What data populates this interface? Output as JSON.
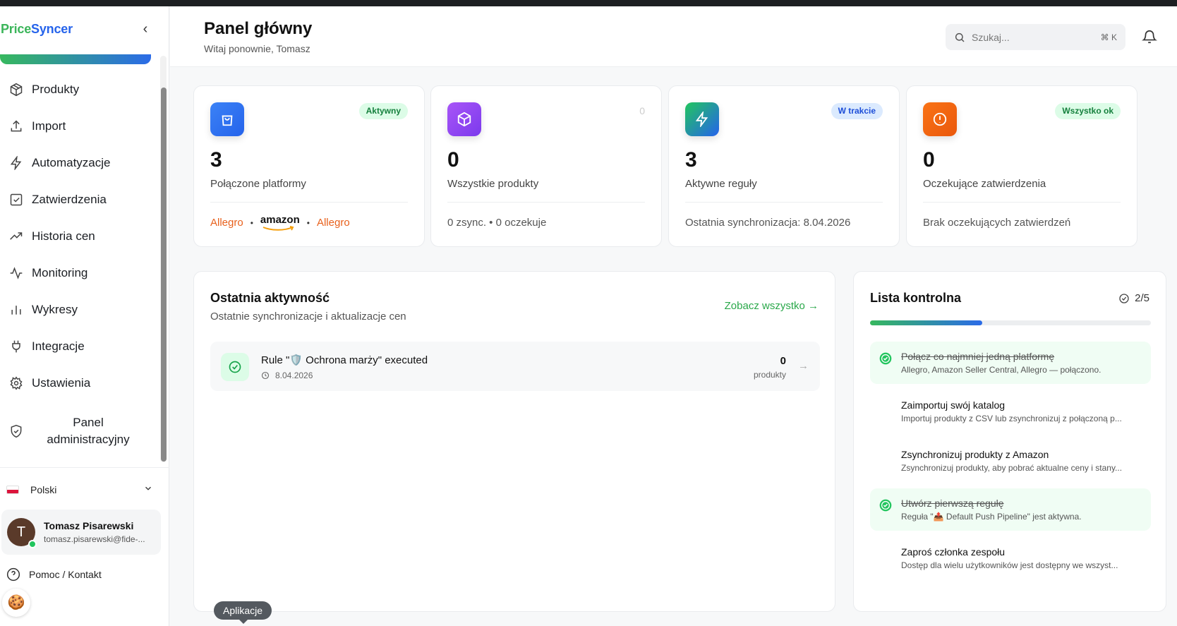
{
  "brand": {
    "part1": "Price",
    "part2": "Syncer"
  },
  "sidebar": {
    "items": [
      {
        "label": "Produkty"
      },
      {
        "label": "Import"
      },
      {
        "label": "Automatyzacje"
      },
      {
        "label": "Zatwierdzenia"
      },
      {
        "label": "Historia cen"
      },
      {
        "label": "Monitoring"
      },
      {
        "label": "Wykresy"
      },
      {
        "label": "Integracje"
      },
      {
        "label": "Ustawienia"
      },
      {
        "label": "Panel administracyjny"
      }
    ],
    "language": "Polski",
    "user": {
      "initial": "T",
      "name": "Tomasz Pisarewski",
      "email": "tomasz.pisarewski@fide-..."
    },
    "help": "Pomoc / Kontakt",
    "cookie_icon": "🍪"
  },
  "header": {
    "title": "Panel główny",
    "subtitle": "Witaj ponownie, Tomasz",
    "search_placeholder": "Szukaj...",
    "search_shortcut": "⌘ K"
  },
  "stats": [
    {
      "value": "3",
      "label": "Połączone platformy",
      "badge": "Aktywny",
      "platforms": [
        "Allegro",
        "amazon",
        "Allegro"
      ]
    },
    {
      "value": "0",
      "label": "Wszystkie produkty",
      "badge": "0",
      "footer": "0 zsync. • 0 oczekuje"
    },
    {
      "value": "3",
      "label": "Aktywne reguły",
      "badge": "W trakcie",
      "footer": "Ostatnia synchronizacja: 8.04.2026"
    },
    {
      "value": "0",
      "label": "Oczekujące zatwierdzenia",
      "badge": "Wszystko ok",
      "footer": "Brak oczekujących zatwierdzeń"
    }
  ],
  "activity": {
    "title": "Ostatnia aktywność",
    "subtitle": "Ostatnie synchronizacje i aktualizacje cen",
    "see_all": "Zobacz wszystko →",
    "rows": [
      {
        "title": "Rule \"🛡️ Ochrona marży\" executed",
        "date": "8.04.2026",
        "count": "0",
        "unit": "produkty"
      }
    ]
  },
  "tooltip": "Aplikacje",
  "checklist": {
    "title": "Lista kontrolna",
    "count": "2/5",
    "progress": 0.4,
    "items": [
      {
        "title": "Połącz co najmniej jedną platformę",
        "desc": "Allegro, Amazon Seller Central, Allegro — połączono.",
        "done": true
      },
      {
        "title": "Zaimportuj swój katalog",
        "desc": "Importuj produkty z CSV lub zsynchronizuj z połączoną p...",
        "done": false
      },
      {
        "title": "Zsynchronizuj produkty z Amazon",
        "desc": "Zsynchronizuj produkty, aby pobrać aktualne ceny i stany...",
        "done": false
      },
      {
        "title": "Utwórz pierwszą regułę",
        "desc": "Reguła \"📤 Default Push Pipeline\" jest aktywna.",
        "done": true
      },
      {
        "title": "Zaproś członka zespołu",
        "desc": "Dostęp dla wielu użytkowników jest dostępny we wszyst...",
        "done": false
      }
    ]
  },
  "colors": {
    "accent_green": "#2aa84a",
    "accent_blue": "#2563eb",
    "allegro_orange": "#e8611d"
  }
}
